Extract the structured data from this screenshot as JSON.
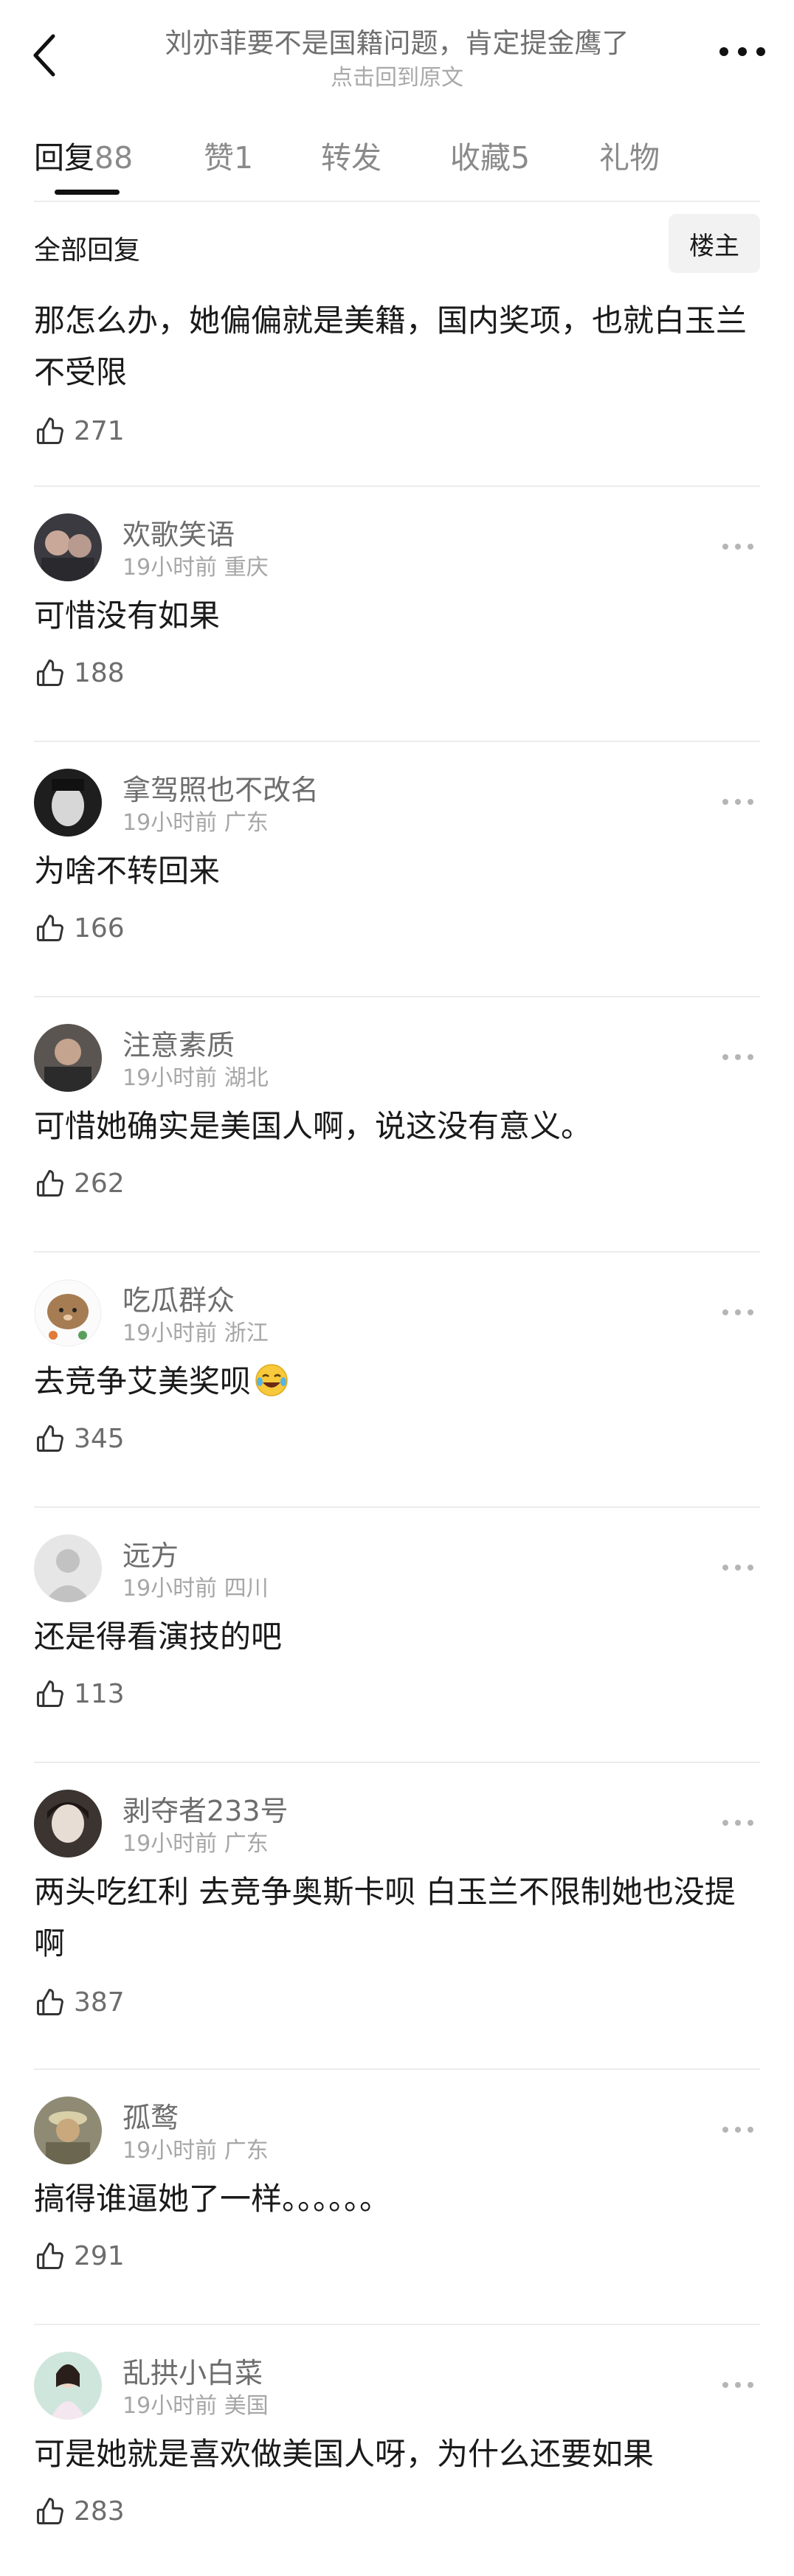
{
  "header": {
    "title": "刘亦菲要不是国籍问题，肯定提金鹰了",
    "subtitle": "点击回到原文"
  },
  "tabs": [
    {
      "label": "回复",
      "count": "88"
    },
    {
      "label": "赞",
      "count": "1"
    },
    {
      "label": "转发",
      "count": ""
    },
    {
      "label": "收藏",
      "count": "5"
    },
    {
      "label": "礼物",
      "count": ""
    }
  ],
  "filter": {
    "label": "全部回复",
    "op_button": "楼主"
  },
  "op_comment": {
    "content": "那怎么办，她偏偏就是美籍，国内奖项，也就白玉兰不受限",
    "likes": "271"
  },
  "comments": [
    {
      "username": "欢歌笑语",
      "time": "19小时前",
      "location": "重庆",
      "content": "可惜没有如果",
      "likes": "188"
    },
    {
      "username": "拿驾照也不改名",
      "time": "19小时前",
      "location": "广东",
      "content": "为啥不转回来",
      "likes": "166"
    },
    {
      "username": "注意素质",
      "time": "19小时前",
      "location": "湖北",
      "content": "可惜她确实是美国人啊，说这没有意义。",
      "likes": "262"
    },
    {
      "username": "吃瓜群众",
      "time": "19小时前",
      "location": "浙江",
      "content": "去竞争艾美奖呗",
      "likes": "345"
    },
    {
      "username": "远方",
      "time": "19小时前",
      "location": "四川",
      "content": "还是得看演技的吧",
      "likes": "113"
    },
    {
      "username": "剥夺者233号",
      "time": "19小时前",
      "location": "广东",
      "content": "两头吃红利 去竞争奥斯卡呗  白玉兰不限制她也没提啊",
      "likes": "387"
    },
    {
      "username": "孤鹜",
      "time": "19小时前",
      "location": "广东",
      "content": "搞得谁逼她了一样。。。。。。",
      "likes": "291"
    },
    {
      "username": "乱拱小白菜",
      "time": "19小时前",
      "location": "美国",
      "content": "可是她就是喜欢做美国人呀，为什么还要如果",
      "likes": "283"
    }
  ],
  "icons": {
    "back": "chevron-left-icon",
    "more": "more-horizontal-icon",
    "like": "thumb-up-icon"
  }
}
